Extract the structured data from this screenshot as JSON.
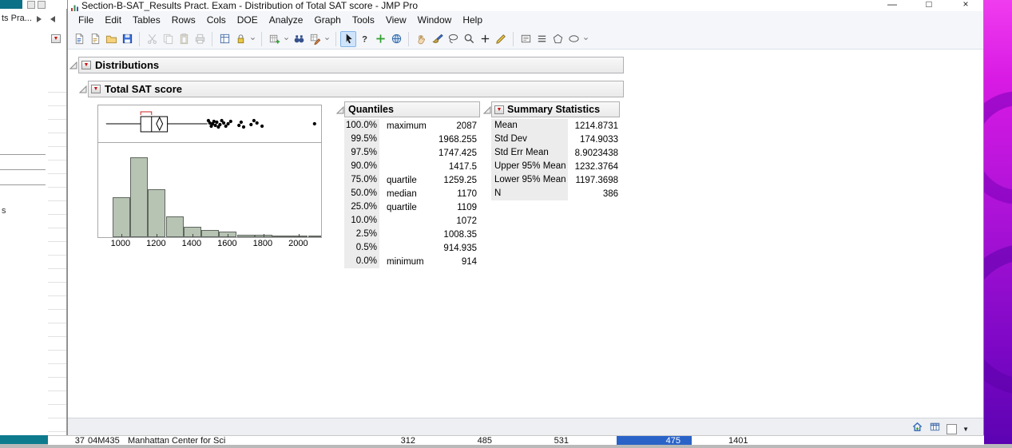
{
  "window": {
    "title": "Section-B-SAT_Results Pract. Exam - Distribution of Total SAT score - JMP Pro",
    "minimize_glyph": "—",
    "maximize_glyph": "□",
    "close_glyph": "×"
  },
  "menu": {
    "items": [
      "File",
      "Edit",
      "Tables",
      "Rows",
      "Cols",
      "DOE",
      "Analyze",
      "Graph",
      "Tools",
      "View",
      "Window",
      "Help"
    ]
  },
  "toolbar": {
    "selected": "arrow-cursor-icon",
    "groups": [
      {
        "icons": [
          "new-journal-icon",
          "new-script-icon",
          "open-icon",
          "save-icon"
        ]
      },
      {
        "icons": [
          "cut-icon",
          "copy-icon",
          "paste-icon",
          "print-icon"
        ],
        "disabled": true
      },
      {
        "icons": [
          "journal-grid-icon",
          "lock-icon",
          "caret-icon"
        ]
      },
      {
        "icons": [
          "new-data-table-icon",
          "caret-icon",
          "binoculars-icon",
          "table-pencil-icon",
          "caret-icon"
        ]
      },
      {
        "icons": [
          "arrow-cursor-icon",
          "help-icon",
          "crosshair-plus-icon",
          "globe-icon"
        ]
      },
      {
        "icons": [
          "hand-icon",
          "brush-icon",
          "lasso-icon",
          "magnifier-icon",
          "plus-icon",
          "pencil-line-icon"
        ]
      },
      {
        "icons": [
          "textbox-icon",
          "list-icon",
          "polygon-icon",
          "oval-icon",
          "caret-icon"
        ]
      }
    ]
  },
  "report": {
    "outline1": "Distributions",
    "outline2": "Total SAT score",
    "quantiles": {
      "title": "Quantiles",
      "rows": [
        {
          "pct": "100.0%",
          "label": "maximum",
          "value": "2087"
        },
        {
          "pct": "99.5%",
          "label": "",
          "value": "1968.255"
        },
        {
          "pct": "97.5%",
          "label": "",
          "value": "1747.425"
        },
        {
          "pct": "90.0%",
          "label": "",
          "value": "1417.5"
        },
        {
          "pct": "75.0%",
          "label": "quartile",
          "value": "1259.25"
        },
        {
          "pct": "50.0%",
          "label": "median",
          "value": "1170"
        },
        {
          "pct": "25.0%",
          "label": "quartile",
          "value": "1109"
        },
        {
          "pct": "10.0%",
          "label": "",
          "value": "1072"
        },
        {
          "pct": "2.5%",
          "label": "",
          "value": "1008.35"
        },
        {
          "pct": "0.5%",
          "label": "",
          "value": "914.935"
        },
        {
          "pct": "0.0%",
          "label": "minimum",
          "value": "914"
        }
      ]
    },
    "summary": {
      "title": "Summary Statistics",
      "rows": [
        {
          "label": "Mean",
          "value": "1214.8731"
        },
        {
          "label": "Std Dev",
          "value": "174.9033"
        },
        {
          "label": "Std Err Mean",
          "value": "8.9023438"
        },
        {
          "label": "Upper 95% Mean",
          "value": "1232.3764"
        },
        {
          "label": "Lower 95% Mean",
          "value": "1197.3698"
        },
        {
          "label": "N",
          "value": "386"
        }
      ]
    }
  },
  "chart_data": {
    "type": "histogram",
    "title": "Total SAT score",
    "xlabel": "Total SAT score",
    "x_ticks": [
      1000,
      1200,
      1400,
      1600,
      1800,
      2000
    ],
    "x_range": [
      870,
      2124
    ],
    "grid": false,
    "bar_color": "#b7c3b3",
    "bins": {
      "start": 950,
      "width": 100
    },
    "counts": [
      70,
      140,
      84,
      36,
      18,
      13,
      10,
      4,
      4,
      3,
      1,
      3
    ],
    "n_total": 386,
    "boxplot": {
      "minimum": 914,
      "q1": 1109,
      "median": 1170,
      "q3": 1259.25,
      "upper_whisker": 1484,
      "mean": 1214.8731,
      "ci_lower": 1197.3698,
      "ci_upper": 1232.3764,
      "outliers": [
        1490,
        1498,
        1506,
        1513,
        1521,
        1529,
        1537,
        1546,
        1555,
        1565,
        1576,
        1588,
        1601,
        1615,
        1662,
        1674,
        1688,
        1730,
        1746,
        1763,
        1792,
        2087
      ]
    }
  },
  "statusbar": {
    "icons": [
      "home-window-icon",
      "data-grid-icon",
      "checkbox-icon",
      "dropdown-caret-icon"
    ]
  },
  "background": {
    "left_tab_label": "ts Pra...",
    "left_text_fragment": "s",
    "bottom_row": [
      "37",
      "04M435",
      "Manhattan Center for Sci",
      "312",
      "485",
      "531",
      "475",
      "1401"
    ]
  }
}
